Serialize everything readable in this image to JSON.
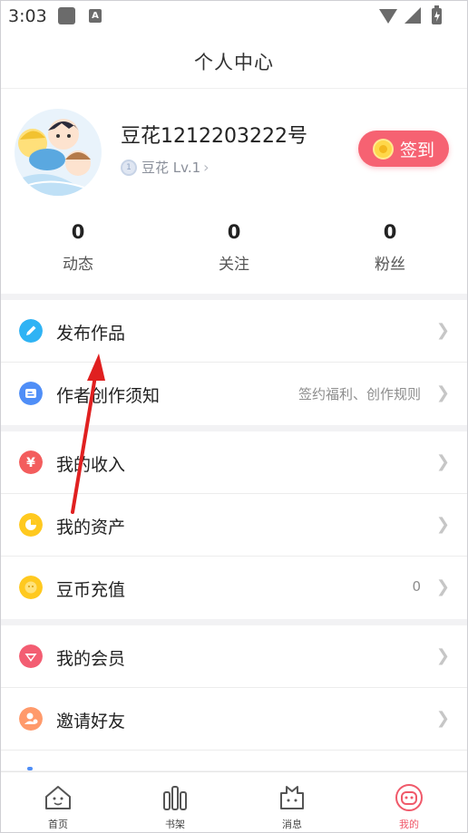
{
  "status_bar": {
    "time": "3:03"
  },
  "header": {
    "title": "个人中心"
  },
  "profile": {
    "username": "豆花1212203222号",
    "level_label": "豆花 Lv.1",
    "level_badge": "1",
    "signin_label": "签到",
    "stats": [
      {
        "value": "0",
        "label": "动态"
      },
      {
        "value": "0",
        "label": "关注"
      },
      {
        "value": "0",
        "label": "粉丝"
      }
    ]
  },
  "menu": {
    "group1": [
      {
        "label": "发布作品",
        "hint": "",
        "icon": "pencil-icon",
        "color": "#2fb3f4"
      },
      {
        "label": "作者创作须知",
        "hint": "签约福利、创作规则",
        "icon": "notice-icon",
        "color": "#4f8ef7"
      }
    ],
    "group2": [
      {
        "label": "我的收入",
        "hint": "",
        "icon": "yen-icon",
        "color": "#f35d5d"
      },
      {
        "label": "我的资产",
        "hint": "",
        "icon": "pie-icon",
        "color": "#ffc91f"
      },
      {
        "label": "豆币充值",
        "hint": "0",
        "icon": "coin-icon",
        "color": "#ffc91f"
      }
    ],
    "group3": [
      {
        "label": "我的会员",
        "hint": "",
        "icon": "vip-icon",
        "color": "#f35d72"
      },
      {
        "label": "邀请好友",
        "hint": "",
        "icon": "friends-icon",
        "color": "#ff9a6b"
      }
    ]
  },
  "bottom_nav": [
    {
      "label": "首页",
      "icon": "home-icon",
      "active": false
    },
    {
      "label": "书架",
      "icon": "bookshelf-icon",
      "active": false
    },
    {
      "label": "消息",
      "icon": "message-icon",
      "active": false
    },
    {
      "label": "我的",
      "icon": "profile-icon",
      "active": true
    }
  ],
  "colors": {
    "accent": "#f66272",
    "active_tab": "#f0596a",
    "annotation_arrow": "#e02020"
  }
}
